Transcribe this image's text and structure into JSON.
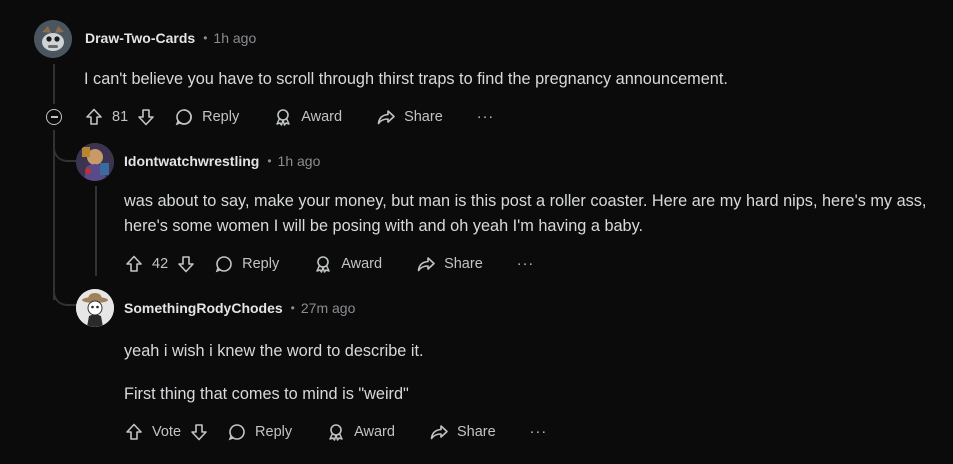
{
  "comments": [
    {
      "username": "Draw-Two-Cards",
      "time": "1h ago",
      "body": [
        "I can't believe you have to scroll through thirst traps to find the pregnancy announcement."
      ],
      "votes": "81",
      "actions": {
        "reply": "Reply",
        "award": "Award",
        "share": "Share",
        "more": "···"
      }
    },
    {
      "username": "Idontwatchwrestling",
      "time": "1h ago",
      "body": [
        "was about to say, make your money, but man is this post a roller coaster. Here are my hard nips, here's my ass, here's some women I will be posing with and oh yeah I'm having a baby."
      ],
      "votes": "42",
      "actions": {
        "reply": "Reply",
        "award": "Award",
        "share": "Share",
        "more": "···"
      }
    },
    {
      "username": "SomethingRodyChodes",
      "time": "27m ago",
      "body": [
        "yeah i wish i knew the word to describe it.",
        "First thing that comes to mind is \"weird\""
      ],
      "votes": "Vote",
      "actions": {
        "reply": "Reply",
        "award": "Award",
        "share": "Share",
        "more": "···"
      }
    }
  ],
  "separator": "•"
}
